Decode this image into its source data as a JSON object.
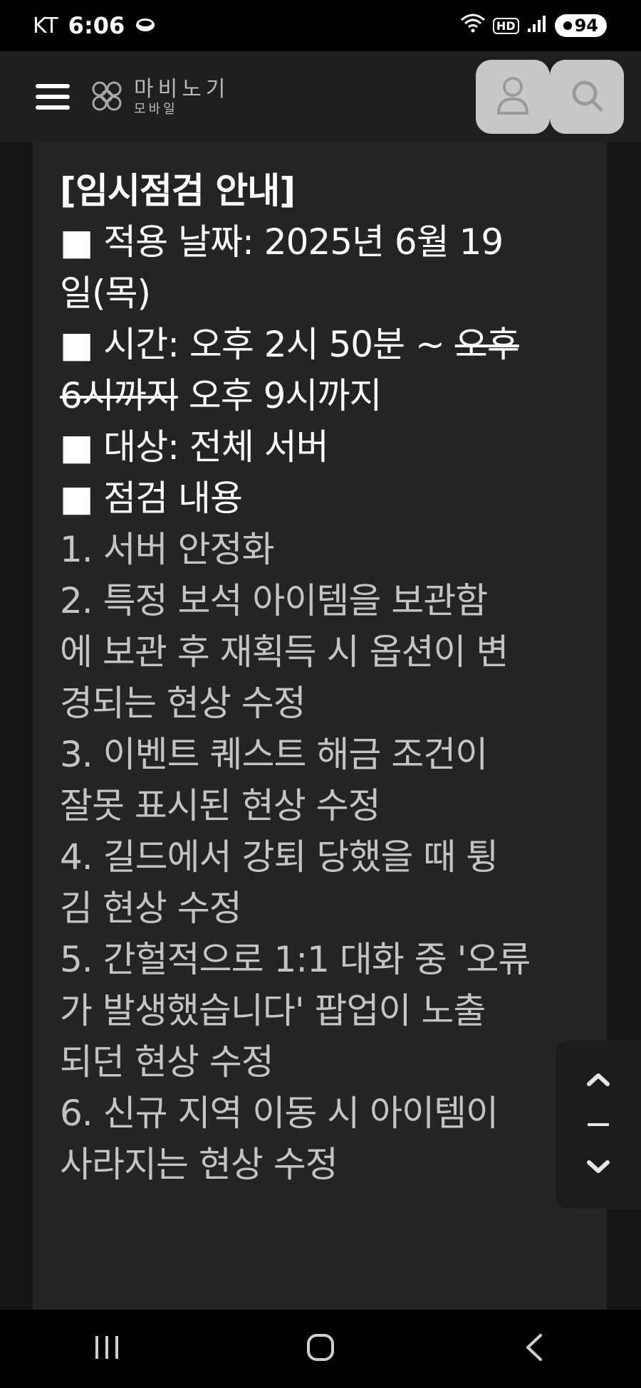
{
  "status": {
    "carrier": "KT",
    "time": "6:06",
    "hd": "HD",
    "battery": "94"
  },
  "header": {
    "logo_main": "마비노기",
    "logo_sub": "모바일"
  },
  "notice": {
    "title": "[임시점검 안내]",
    "date_line1": "■ 적용 날짜: 2025년 6월 19",
    "date_line2": "일(목)",
    "time_line1_prefix": "■ 시간: 오후 2시 50분 ~ ",
    "time_line1_strike": "오후",
    "time_line2_strike": "6시까지",
    "time_line2_rest": " 오후 9시까지",
    "target": "■ 대상: 전체 서버",
    "content_heading": "■ 점검 내용",
    "items": [
      "1. 서버 안정화",
      "2. 특정 보석 아이템을 보관함",
      "에 보관 후 재획득 시 옵션이 변",
      "경되는 현상 수정",
      "3. 이벤트 퀘스트 해금 조건이",
      "잘못 표시된 현상 수정",
      "4. 길드에서 강퇴 당했을 때 튕",
      "김 현상 수정",
      "5. 간헐적으로 1:1 대화 중 '오류",
      "가 발생했습니다' 팝업이 노출",
      "되던 현상 수정",
      "6. 신규 지역 이동 시 아이템이",
      "사라지는 현상 수정"
    ]
  }
}
